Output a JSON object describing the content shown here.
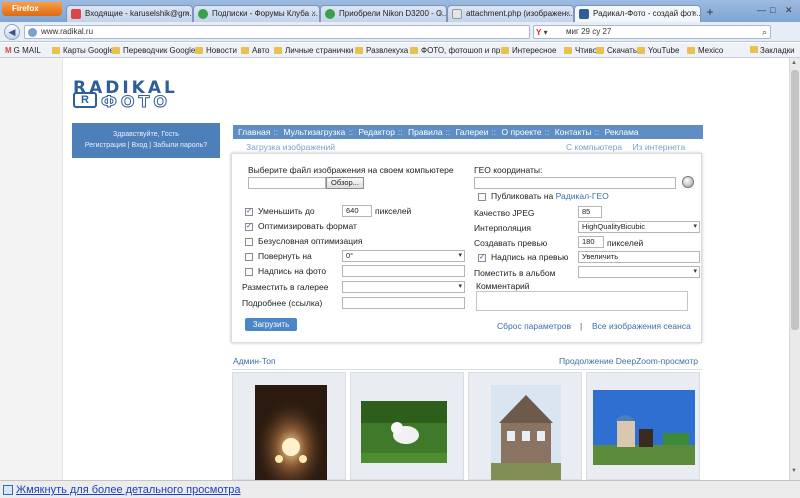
{
  "browser": {
    "app_button": "Firefox",
    "tabs": [
      {
        "label": "Входящие - karuselshik@gm...",
        "active": false,
        "icon_color": "#d44"
      },
      {
        "label": "Подписки - Форумы Клуба ...",
        "active": false,
        "icon_color": "#3aa04a"
      },
      {
        "label": "Приобрели Nikon D3200 - С...",
        "active": false,
        "icon_color": "#3aa04a"
      },
      {
        "label": "attachment.php (изображен...",
        "active": false,
        "icon_color": "#cfcfcf"
      },
      {
        "label": "Радикал-Фото - создай фот...",
        "active": true,
        "icon_color": "#2f5f97"
      }
    ],
    "new_tab": "+",
    "url": "www.radikal.ru",
    "search_engine": "Y",
    "search_text": "миг 29 су 27",
    "bookmarks": [
      {
        "label": "G MAIL",
        "kind": "gmail"
      },
      {
        "label": "Карты Google",
        "kind": "folder"
      },
      {
        "label": "Переводчик Google",
        "kind": "folder"
      },
      {
        "label": "Новости",
        "kind": "folder"
      },
      {
        "label": "Авто",
        "kind": "folder"
      },
      {
        "label": "Личные странички",
        "kind": "folder"
      },
      {
        "label": "Развлекуха",
        "kind": "folder"
      },
      {
        "label": "ФОТО, фотошоп и пр.",
        "kind": "folder"
      },
      {
        "label": "Интересное",
        "kind": "folder"
      },
      {
        "label": "Чтиво",
        "kind": "folder"
      },
      {
        "label": "Скачать",
        "kind": "folder"
      },
      {
        "label": "YouTube",
        "kind": "folder"
      },
      {
        "label": "Mexico",
        "kind": "folder"
      }
    ],
    "bookmarks_right": "Закладки"
  },
  "site": {
    "logo_top": "RADIKAL",
    "logo_bottom": "ФОТО",
    "logo_r": "R",
    "greeting": "Здравствуйте, Гость",
    "register": "Регистрация",
    "login": "Вход",
    "forgot": "Забыли пароль?",
    "nav": [
      "Главная",
      "Мультизагрузка",
      "Редактор",
      "Правила",
      "Галереи",
      "О проекте",
      "Контакты",
      "Реклама"
    ],
    "subnav_left": "Загрузка изображений",
    "subnav_right": [
      "С компьютера",
      "Из интернета"
    ]
  },
  "form": {
    "file_label": "Выберите файл изображения на своем компьютере",
    "browse": "Обзор...",
    "reduce_label": "Уменьшить до",
    "reduce_value": "640",
    "reduce_unit": "пикселей",
    "optimize_label": "Оптимизировать формат",
    "force_opt_label": "Безусловная оптимизация",
    "rotate_label": "Повернуть на",
    "rotate_value": "0°",
    "caption_label": "Надпись на фото",
    "gallery_label": "Разместить в галерее",
    "more_label": "Подробнее (ссылка)",
    "upload": "Загрузить",
    "geo_label": "ГЕО координаты:",
    "publish_label": "Публиковать на",
    "publish_link": "Радикал-ГЕО",
    "jpeg_label": "Качество JPEG",
    "jpeg_value": "85",
    "interp_label": "Интерполяция",
    "interp_value": "HighQualityBicubic",
    "preview_label": "Создавать превью",
    "preview_value": "180",
    "preview_unit": "пикселей",
    "preview_caption_label": "Надпись на превью",
    "preview_caption_value": "Увеличить",
    "album_label": "Поместить в альбом",
    "comment_label": "Комментарий",
    "reset": "Сброс параметров",
    "sep": "|",
    "session": "Все изображения сеанса",
    "checked": {
      "reduce": true,
      "optimize": true,
      "force": false,
      "rotate": false,
      "caption": false,
      "publish": false,
      "preview_caption": true
    }
  },
  "gallery": {
    "title": "Админ-Топ",
    "more": "Продолжение",
    "deepzoom": "DeepZoom-просмотр",
    "items": [
      "chandelier-photo",
      "cat-on-grass-photo",
      "wooden-house-photo",
      "chapel-photo"
    ]
  },
  "status": {
    "zoom_text": "Жмякнуть для более детального просмотра"
  }
}
